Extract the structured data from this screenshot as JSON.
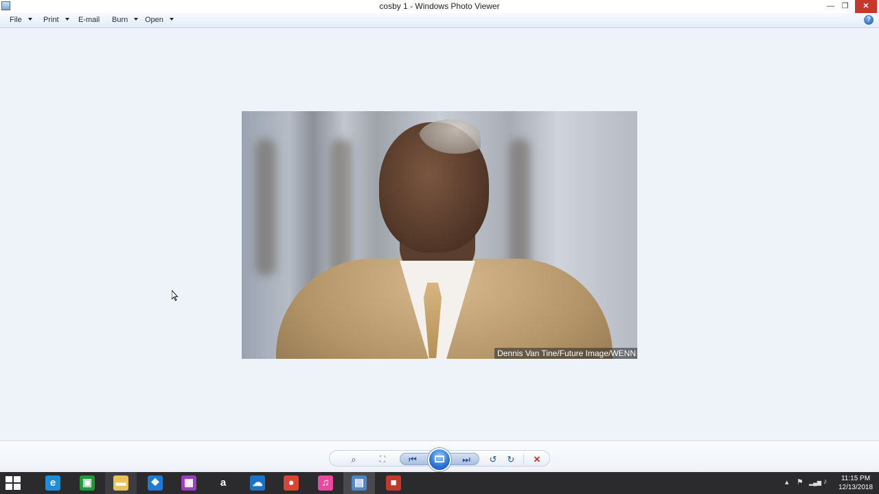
{
  "window": {
    "title": "cosby 1 - Windows Photo Viewer",
    "icon": "photo-viewer-icon",
    "controls": {
      "minimize": "—",
      "restore": "❐",
      "close": "✕"
    }
  },
  "menubar": {
    "items": [
      {
        "label": "File",
        "has_dropdown": true
      },
      {
        "label": "Print",
        "has_dropdown": true
      },
      {
        "label": "E-mail",
        "has_dropdown": false
      },
      {
        "label": "Burn",
        "has_dropdown": true
      },
      {
        "label": "Open",
        "has_dropdown": true
      }
    ],
    "help_icon": "help-icon"
  },
  "photo": {
    "caption_credit": "Dennis Van Tine/Future Image/WENN"
  },
  "controlbar": {
    "zoom": "⌕",
    "actual_size": "⛶",
    "previous": "⏮",
    "slideshow": "slideshow-icon",
    "next": "⏭",
    "rotate_ccw": "↺",
    "rotate_cw": "↻",
    "delete": "✕"
  },
  "taskbar": {
    "apps": [
      {
        "name": "internet-explorer",
        "glyph": "e",
        "color": "#1e8fd6"
      },
      {
        "name": "store",
        "glyph": "▣",
        "color": "#1f9a3a"
      },
      {
        "name": "file-explorer",
        "glyph": "▬",
        "color": "#e8c35a"
      },
      {
        "name": "dropbox",
        "glyph": "❖",
        "color": "#1f7ad6"
      },
      {
        "name": "photos-app",
        "glyph": "▦",
        "color": "#9b3fbf"
      },
      {
        "name": "amazon",
        "glyph": "a",
        "color": "#2b2b2e"
      },
      {
        "name": "onedrive",
        "glyph": "☁",
        "color": "#1a73c9"
      },
      {
        "name": "chrome",
        "glyph": "●",
        "color": "#d94534"
      },
      {
        "name": "itunes",
        "glyph": "♫",
        "color": "#e84aa0"
      },
      {
        "name": "photo-viewer",
        "glyph": "▤",
        "color": "#4f86c6"
      },
      {
        "name": "screen-recorder",
        "glyph": "■",
        "color": "#c0392b"
      }
    ],
    "tray": {
      "chevron": "▴",
      "flag": "⚑",
      "signal": "▂▄▆",
      "volume": "♪"
    },
    "clock": {
      "time": "11:15 PM",
      "date": "12/13/2018"
    }
  }
}
